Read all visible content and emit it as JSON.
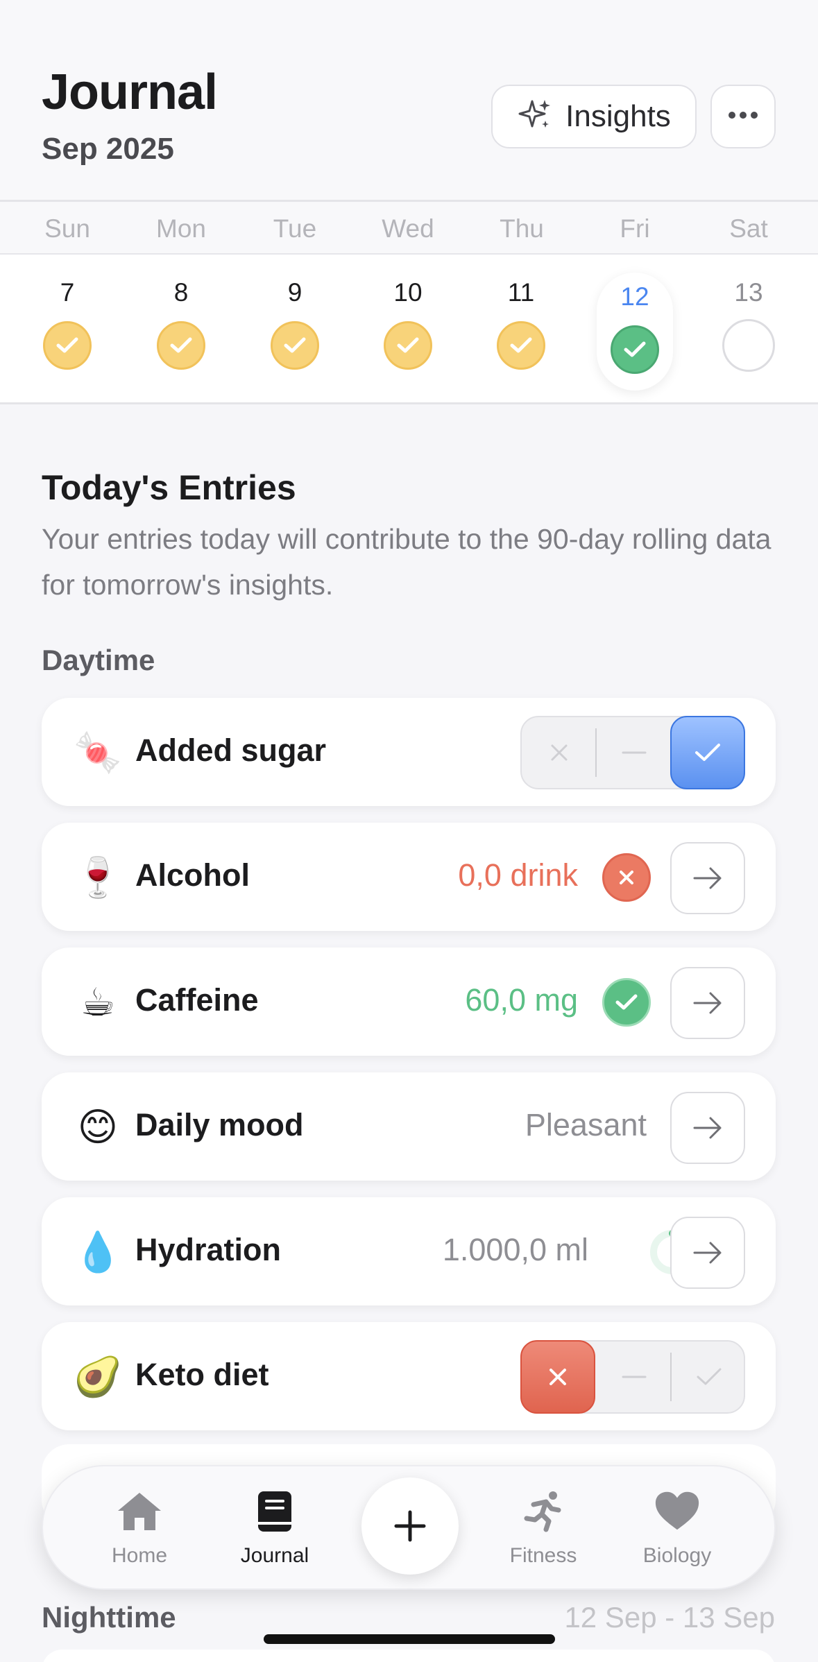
{
  "header": {
    "title": "Journal",
    "subtitle": "Sep 2025",
    "insights_label": "Insights",
    "more_icon": "ellipsis-icon"
  },
  "week": {
    "day_names": [
      "Sun",
      "Mon",
      "Tue",
      "Wed",
      "Thu",
      "Fri",
      "Sat"
    ],
    "days": [
      {
        "num": "7",
        "status": "done"
      },
      {
        "num": "8",
        "status": "done"
      },
      {
        "num": "9",
        "status": "done"
      },
      {
        "num": "10",
        "status": "done"
      },
      {
        "num": "11",
        "status": "done"
      },
      {
        "num": "12",
        "status": "today-done"
      },
      {
        "num": "13",
        "status": "empty"
      }
    ]
  },
  "section": {
    "title": "Today's Entries",
    "description": "Your entries today will contribute to the 90-day rolling data for tomorrow's insights.",
    "group_daytime": "Daytime",
    "group_nighttime": "Nighttime",
    "night_range": "12 Sep - 13 Sep"
  },
  "entries": [
    {
      "emoji": "🍬",
      "name": "Added sugar",
      "control": "segmented",
      "selected": "yes"
    },
    {
      "emoji": "🍷",
      "name": "Alcohol",
      "value": "0,0 drink",
      "status": "bad"
    },
    {
      "emoji": "☕",
      "name": "Caffeine",
      "value": "60,0 mg",
      "status": "good"
    },
    {
      "emoji": "😊",
      "name": "Daily mood",
      "value": "Pleasant"
    },
    {
      "emoji": "💧",
      "name": "Hydration",
      "value": "1.000,0 ml",
      "progress": 0.45
    },
    {
      "emoji": "🥑",
      "name": "Keto diet",
      "control": "segmented",
      "selected": "no"
    }
  ],
  "tabbar": {
    "tabs": [
      {
        "label": "Home",
        "icon": "house-icon"
      },
      {
        "label": "Journal",
        "icon": "journal-icon",
        "active": true
      },
      {
        "label": "Fitness",
        "icon": "runner-icon"
      },
      {
        "label": "Biology",
        "icon": "heart-icon"
      }
    ],
    "add_icon": "plus-icon"
  },
  "colors": {
    "accent_blue": "#4a86f0",
    "done_yellow": "#f8d37a",
    "good_green": "#5bbf85",
    "bad_red": "#e8705a"
  }
}
